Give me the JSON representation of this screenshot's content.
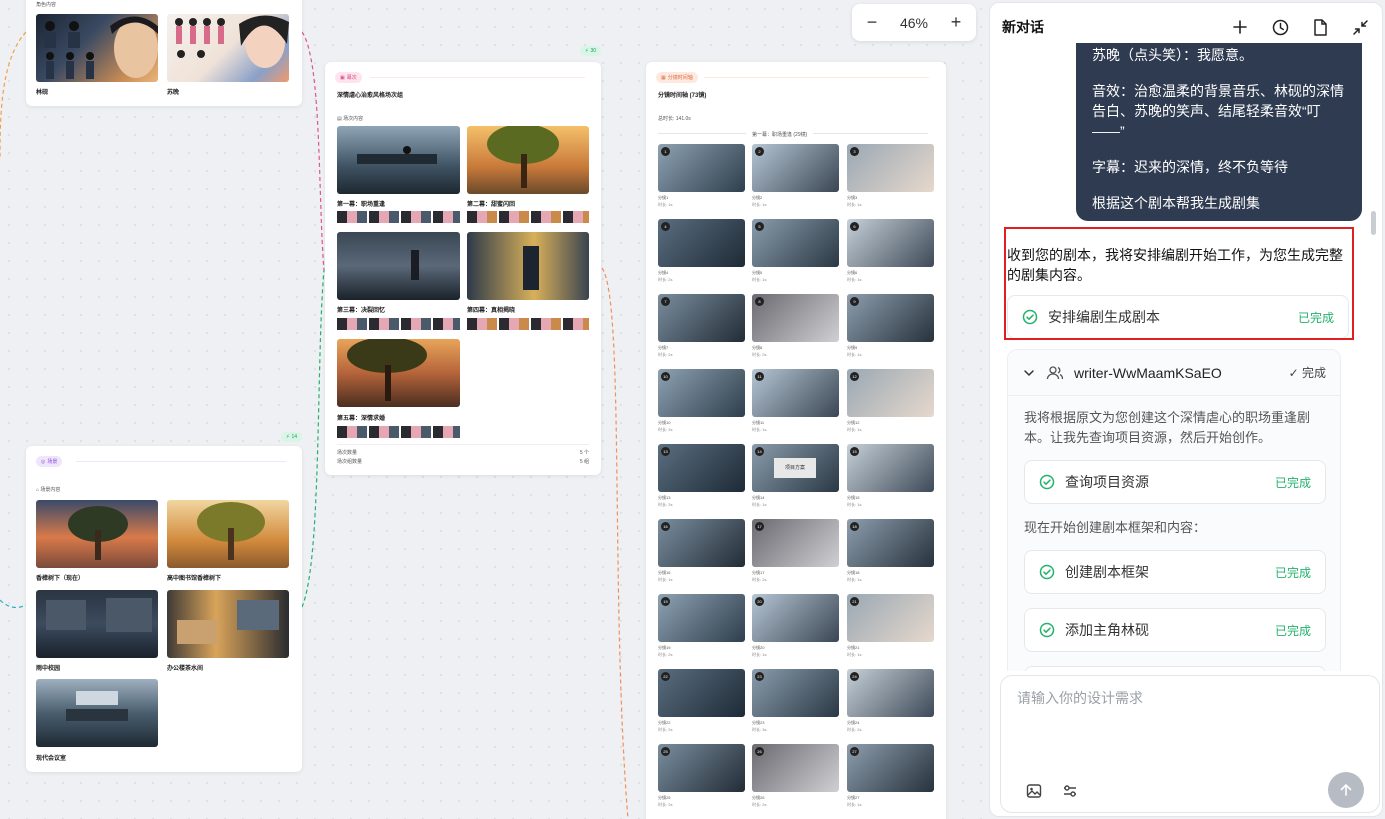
{
  "colors": {
    "accent_green": "#23b26d",
    "user_bubble": "#2f3b51",
    "highlight_red": "#e02020"
  },
  "canvas": {
    "zoom": {
      "minus": "−",
      "value": "46%",
      "plus": "+"
    },
    "characters_card": {
      "section_label": "角色内容",
      "names": [
        "林砚",
        "苏晚"
      ]
    },
    "scenes_card": {
      "tag": "场景",
      "section_label": "场景内容",
      "badge": "14",
      "names": [
        "香樟树下（现在）",
        "高中图书馆香樟树下",
        "雨中校园",
        "办公楼茶水间",
        "现代会议室"
      ]
    },
    "acts_card": {
      "badge": "30",
      "tag": "幕次",
      "title": "深情虐心治愈风格场次组",
      "section_label": "场次内容",
      "acts": [
        "第一幕：职场重逢",
        "第二幕：甜蜜闪回",
        "第三幕：决裂回忆",
        "第四幕：真相揭晓",
        "第五幕：深情求婚"
      ],
      "stat1_label": "场次数量",
      "stat1_value": "5 个",
      "stat2_label": "场次组数量",
      "stat2_value": "5 组"
    },
    "storyboard_card": {
      "tag": "分镜时间轴",
      "title": "分镜时间轴 (73镜)",
      "total": "总时长: 141.0s",
      "section": "第一幕：职场重逢 (29镜)",
      "shot_prefix": "分镜",
      "dur_label": "时长:",
      "durs": [
        "1s",
        "1s",
        "1s",
        "2s",
        "1s",
        "1s",
        "2s",
        "2s",
        "1s",
        "2s",
        "1s",
        "1s",
        "2s",
        "1s",
        "1s",
        "1s",
        "2s",
        "1s",
        "2s",
        "1s",
        "1s",
        "2s",
        "3s",
        "2s",
        "2s",
        "2s",
        "1s"
      ],
      "screen_text": "项目方案"
    }
  },
  "panel": {
    "title": "新对话",
    "user_message": {
      "lines": [
        "苏晚（点头笑）：我愿意。",
        "音效：治愈温柔的背景音乐、林砚的深情告白、苏晚的笑声、结尾轻柔音效“叮——”",
        "字幕：迟来的深情，终不负等待",
        "根据这个剧本帮我生成剧集"
      ]
    },
    "reply": "收到您的剧本，我将安排编剧开始工作，为您生成完整的剧集内容。",
    "main_task": {
      "label": "安排编剧生成剧本",
      "status": "已完成"
    },
    "writer": {
      "name": "writer-WwMaamKSaEO",
      "status": "✓ 完成",
      "intro": "我将根据原文为您创建这个深情虐心的职场重逢剧本。让我先查询项目资源，然后开始创作。",
      "tasks": [
        {
          "label": "查询项目资源",
          "status": "已完成"
        },
        {
          "label": "创建剧本框架",
          "status": "已完成"
        },
        {
          "label": "添加主角林砚",
          "status": "已完成"
        }
      ],
      "mid_text": "现在开始创建剧本框架和内容："
    },
    "input": {
      "placeholder": "请输入你的设计需求"
    }
  }
}
